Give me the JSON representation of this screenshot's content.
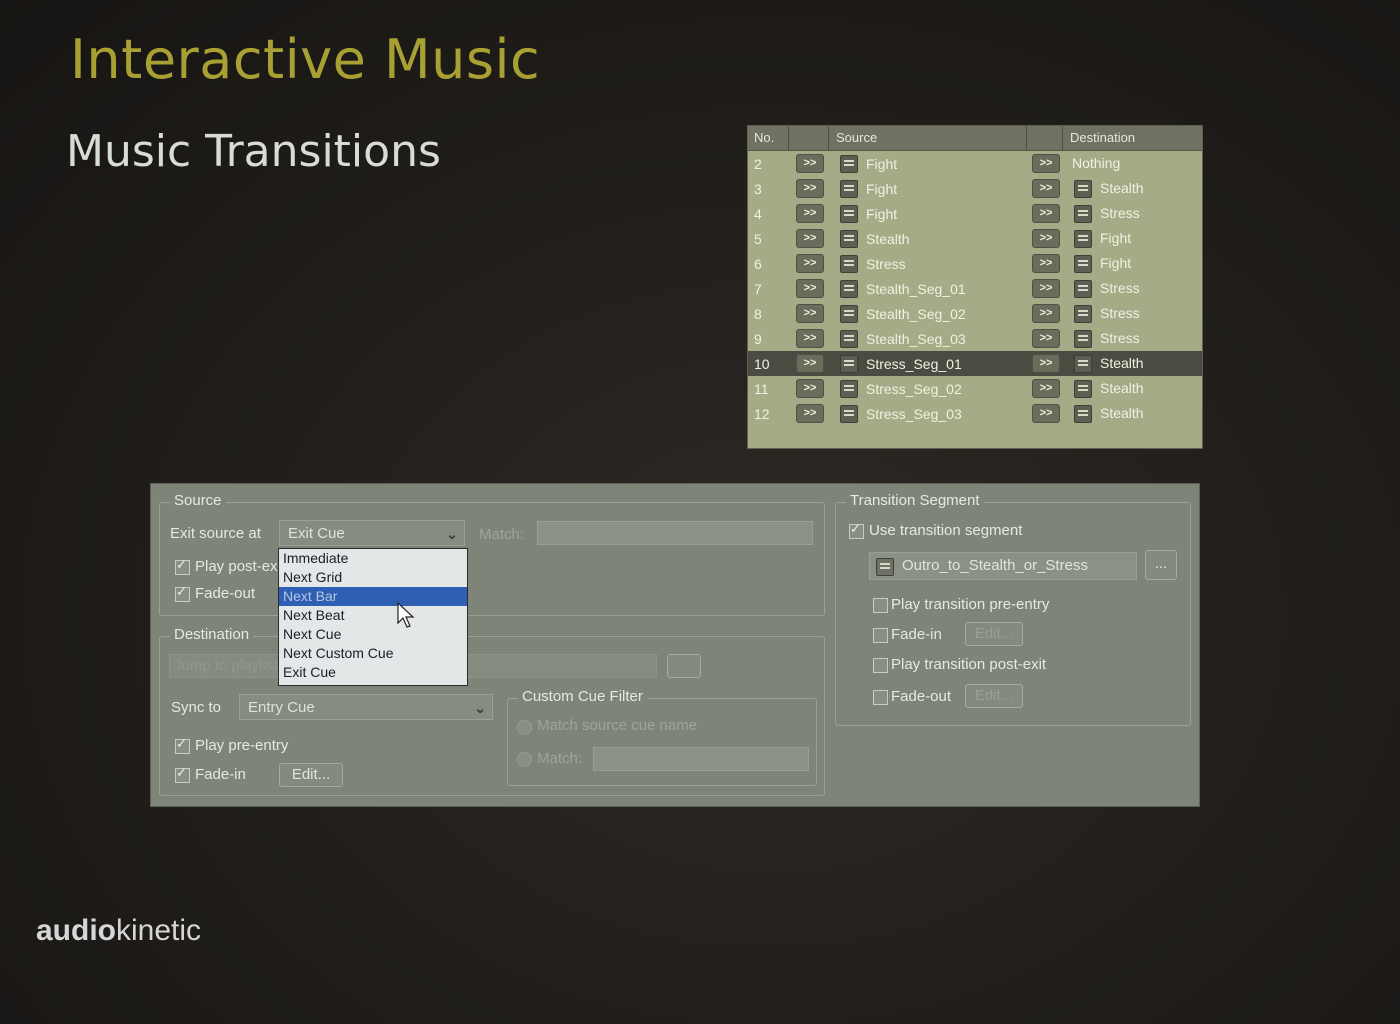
{
  "slide": {
    "title": "Interactive Music",
    "subtitle": "Music Transitions",
    "logo_bold": "audio",
    "logo_rest": "kinetic"
  },
  "transitions_table": {
    "headers": {
      "no": "No.",
      "source": "Source",
      "destination": "Destination"
    },
    "arrow_label": ">>",
    "rows": [
      {
        "no": "2",
        "source": "Fight",
        "destination": "Nothing",
        "source_icon": "segment-icon",
        "destination_icon": ""
      },
      {
        "no": "3",
        "source": "Fight",
        "destination": "Stealth",
        "source_icon": "segment-icon",
        "destination_icon": "segment-icon"
      },
      {
        "no": "4",
        "source": "Fight",
        "destination": "Stress",
        "source_icon": "segment-icon",
        "destination_icon": "segment-icon"
      },
      {
        "no": "5",
        "source": "Stealth",
        "destination": "Fight",
        "source_icon": "segment-icon",
        "destination_icon": "segment-icon"
      },
      {
        "no": "6",
        "source": "Stress",
        "destination": "Fight",
        "source_icon": "segment-icon",
        "destination_icon": "segment-icon"
      },
      {
        "no": "7",
        "source": "Stealth_Seg_01",
        "destination": "Stress",
        "source_icon": "grid-segment-icon",
        "destination_icon": "segment-icon"
      },
      {
        "no": "8",
        "source": "Stealth_Seg_02",
        "destination": "Stress",
        "source_icon": "grid-segment-icon",
        "destination_icon": "segment-icon"
      },
      {
        "no": "9",
        "source": "Stealth_Seg_03",
        "destination": "Stress",
        "source_icon": "grid-segment-icon",
        "destination_icon": "segment-icon"
      },
      {
        "no": "10",
        "source": "Stress_Seg_01",
        "destination": "Stealth",
        "source_icon": "grid-segment-icon",
        "destination_icon": "segment-icon",
        "selected": true
      },
      {
        "no": "11",
        "source": "Stress_Seg_02",
        "destination": "Stealth",
        "source_icon": "grid-segment-icon",
        "destination_icon": "segment-icon"
      },
      {
        "no": "12",
        "source": "Stress_Seg_03",
        "destination": "Stealth",
        "source_icon": "grid-segment-icon",
        "destination_icon": "segment-icon"
      }
    ]
  },
  "source_group": {
    "label": "Source",
    "exit_source_label": "Exit source at",
    "exit_source_value": "Exit Cue",
    "match_label": "Match:",
    "play_post_exit_label": "Play post-exit",
    "play_post_exit_checked": true,
    "fade_out_label": "Fade-out",
    "fade_out_checked": true
  },
  "dropdown": {
    "options": [
      "Immediate",
      "Next Grid",
      "Next Bar",
      "Next Beat",
      "Next Cue",
      "Next Custom Cue",
      "Exit Cue"
    ],
    "highlighted": "Next Bar"
  },
  "destination_group": {
    "label": "Destination",
    "jump_label": "Jump to playlist item",
    "sync_to_label": "Sync to",
    "sync_to_value": "Entry Cue",
    "play_pre_entry_label": "Play pre-entry",
    "play_pre_entry_checked": true,
    "fade_in_label": "Fade-in",
    "fade_in_checked": true,
    "edit_label": "Edit..."
  },
  "custom_cue_filter": {
    "label": "Custom Cue Filter",
    "match_source_label": "Match source cue name",
    "match_label": "Match:"
  },
  "transition_segment": {
    "label": "Transition Segment",
    "use_label": "Use transition segment",
    "use_checked": true,
    "segment_name": "Outro_to_Stealth_or_Stress",
    "browse_label": "...",
    "play_pre_entry_label": "Play transition pre-entry",
    "play_pre_entry_checked": false,
    "fade_in_label": "Fade-in",
    "fade_in_checked": false,
    "play_post_exit_label": "Play transition post-exit",
    "play_post_exit_checked": false,
    "fade_out_label": "Fade-out",
    "fade_out_checked": false,
    "edit_label": "Edit..."
  }
}
